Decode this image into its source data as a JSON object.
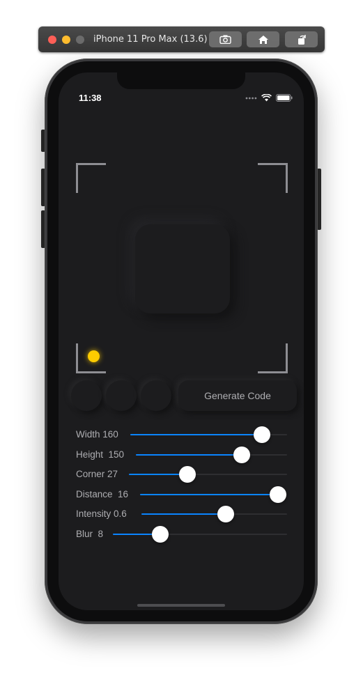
{
  "simulator": {
    "title": "iPhone 11 Pro Max (13.6)"
  },
  "status_bar": {
    "time": "11:38"
  },
  "controls": {
    "generate_label": "Generate Code"
  },
  "sliders": [
    {
      "label": "Width 160",
      "value": 0.84
    },
    {
      "label": "Height  150",
      "value": 0.7
    },
    {
      "label": "Corner 27",
      "value": 0.37
    },
    {
      "label": "Distance  16",
      "value": 0.94
    },
    {
      "label": "Intensity 0.6",
      "value": 0.58
    },
    {
      "label": "Blur  8",
      "value": 0.27
    }
  ],
  "colors": {
    "accent": "#0a84ff",
    "light_source": "#ffcc00",
    "background": "#1c1c1e"
  }
}
